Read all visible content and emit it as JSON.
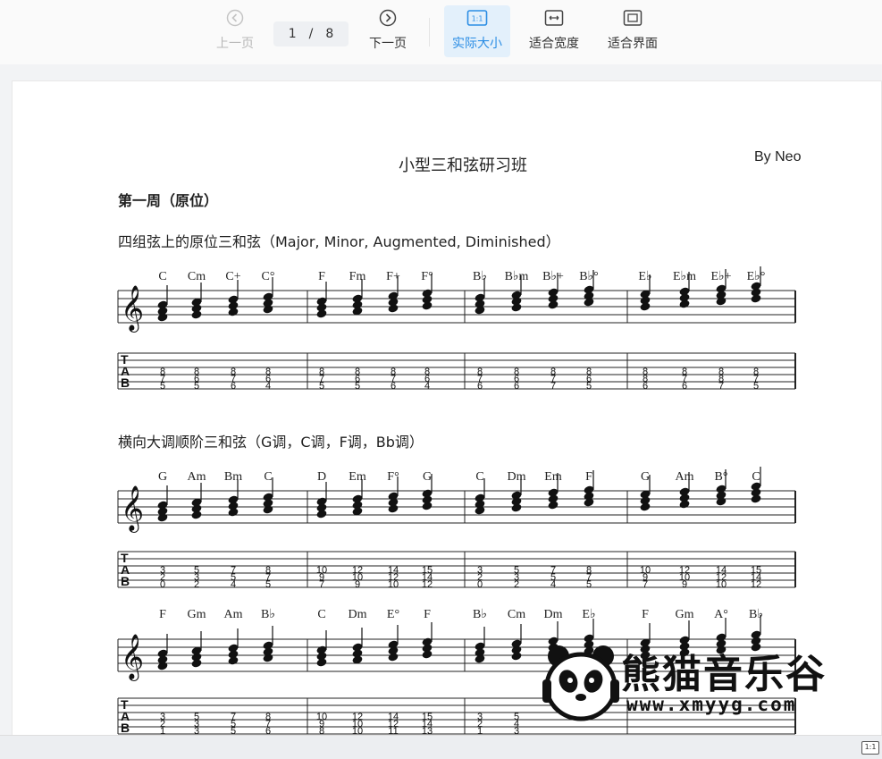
{
  "toolbar": {
    "prev_label": "上一页",
    "current_page": "1",
    "page_sep": "/",
    "total_pages": "8",
    "next_label": "下一页",
    "actual_size_label": "实际大小",
    "actual_size_icon_text": "1:1",
    "fit_width_label": "适合宽度",
    "fit_page_label": "适合界面"
  },
  "document": {
    "title": "小型三和弦研习班",
    "author": "By Neo",
    "week_heading": "第一周（原位）",
    "section1": "四组弦上的原位三和弦（Major, Minor, Augmented, Diminished）",
    "section2": "横向大调顺阶三和弦（G调，C调，F调，Bb调）"
  },
  "score": {
    "row1_chords": [
      "C",
      "Cm",
      "C+",
      "C°",
      "F",
      "Fm",
      "F+",
      "F°",
      "B♭",
      "B♭m",
      "B♭+",
      "B♭°",
      "E♭",
      "E♭m",
      "E♭+",
      "E♭°"
    ],
    "row1_tab": [
      [
        "5",
        "7",
        "8"
      ],
      [
        "5",
        "6",
        "8"
      ],
      [
        "6",
        "7",
        "8"
      ],
      [
        "4",
        "6",
        "8"
      ],
      [
        "5",
        "7",
        "8"
      ],
      [
        "5",
        "6",
        "8"
      ],
      [
        "6",
        "7",
        "8"
      ],
      [
        "4",
        "6",
        "8"
      ],
      [
        "6",
        "7",
        "8"
      ],
      [
        "6",
        "6",
        "8"
      ],
      [
        "7",
        "7",
        "8"
      ],
      [
        "5",
        "6",
        "8"
      ],
      [
        "6",
        "8",
        "8"
      ],
      [
        "6",
        "7",
        "8"
      ],
      [
        "7",
        "8",
        "8"
      ],
      [
        "5",
        "7",
        "8"
      ]
    ],
    "row2_chords": [
      "G",
      "Am",
      "Bm",
      "C",
      "D",
      "Em",
      "F°",
      "G",
      "C",
      "Dm",
      "Em",
      "F",
      "G",
      "Am",
      "B°",
      "C"
    ],
    "row2_tab": [
      [
        "0",
        "2",
        "3"
      ],
      [
        "2",
        "3",
        "5"
      ],
      [
        "4",
        "5",
        "7"
      ],
      [
        "5",
        "7",
        "8"
      ],
      [
        "7",
        "9",
        "10"
      ],
      [
        "9",
        "10",
        "12"
      ],
      [
        "10",
        "12",
        "14"
      ],
      [
        "12",
        "14",
        "15"
      ],
      [
        "0",
        "2",
        "3"
      ],
      [
        "2",
        "3",
        "5"
      ],
      [
        "4",
        "5",
        "7"
      ],
      [
        "5",
        "7",
        "8"
      ],
      [
        "7",
        "9",
        "10"
      ],
      [
        "9",
        "10",
        "12"
      ],
      [
        "10",
        "12",
        "14"
      ],
      [
        "12",
        "14",
        "15"
      ]
    ],
    "row3_chords": [
      "F",
      "Gm",
      "Am",
      "B♭",
      "C",
      "Dm",
      "E°",
      "F",
      "B♭",
      "Cm",
      "Dm",
      "E♭",
      "F",
      "Gm",
      "A°",
      "B♭"
    ],
    "row3_tab": [
      [
        "1",
        "2",
        "3"
      ],
      [
        "3",
        "3",
        "5"
      ],
      [
        "5",
        "5",
        "7"
      ],
      [
        "6",
        "7",
        "8"
      ],
      [
        "8",
        "9",
        "10"
      ],
      [
        "10",
        "10",
        "12"
      ],
      [
        "11",
        "12",
        "14"
      ],
      [
        "13",
        "14",
        "15"
      ],
      [
        "1",
        "2",
        "3"
      ],
      [
        "3",
        "4",
        "5"
      ],
      [
        "",
        "",
        ""
      ],
      [
        "",
        "",
        ""
      ],
      [
        "",
        "",
        ""
      ],
      [
        "",
        "",
        ""
      ],
      [
        "",
        "",
        ""
      ],
      [
        "",
        "",
        ""
      ]
    ],
    "tab_letters": [
      "T",
      "A",
      "B"
    ]
  },
  "watermark": {
    "text": "熊猫音乐谷",
    "url": "www.xmyyg.com"
  },
  "statusbar": {
    "zoom_badge": "1:1"
  }
}
